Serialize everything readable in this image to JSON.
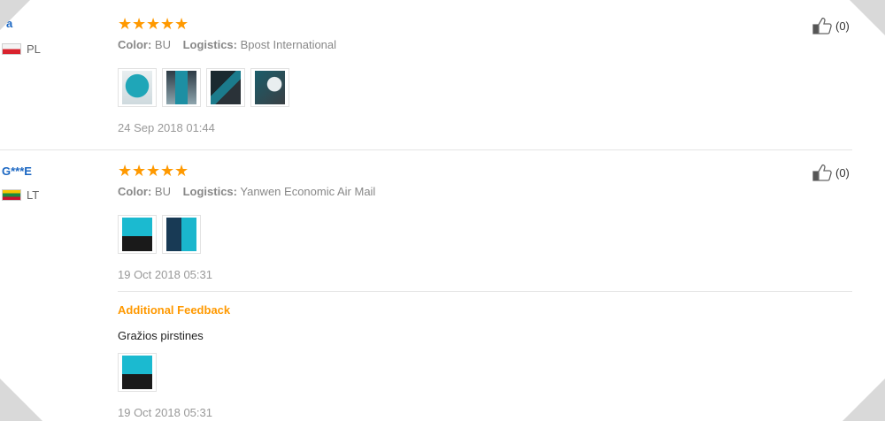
{
  "reviews": [
    {
      "user": "*a",
      "country_code": "PL",
      "rating": 5,
      "stars": [
        "★",
        "★",
        "★",
        "★",
        "★"
      ],
      "color_label": "Color:",
      "color_value": "BU",
      "logistics_label": "Logistics:",
      "logistics_value": "Bpost International",
      "images": [
        "glove-photo-1",
        "glove-photo-2",
        "glove-photo-3",
        "glove-photo-4"
      ],
      "date": "24 Sep 2018 01:44",
      "helpful_count": "(0)"
    },
    {
      "user": "G***E",
      "country_code": "LT",
      "rating": 5,
      "stars": [
        "★",
        "★",
        "★",
        "★",
        "★"
      ],
      "color_label": "Color:",
      "color_value": "BU",
      "logistics_label": "Logistics:",
      "logistics_value": "Yanwen Economic Air Mail",
      "images": [
        "glove-photo-1",
        "glove-photo-2"
      ],
      "date": "19 Oct 2018 05:31",
      "helpful_count": "(0)",
      "additional": {
        "title": "Additional Feedback",
        "text": "Gražios pirstines",
        "images": [
          "glove-photo-1"
        ],
        "date": "19 Oct 2018 05:31"
      }
    }
  ],
  "colors": {
    "username": "#1a66c2",
    "star": "#ff9900",
    "additional_title": "#ff9900",
    "meta_text": "#888888",
    "separator": "#e5e5e5"
  },
  "icons": {
    "helpful": "thumbs-up-icon",
    "star": "star-icon",
    "flag_pl": "flag-pl-icon",
    "flag_lt": "flag-lt-icon"
  }
}
